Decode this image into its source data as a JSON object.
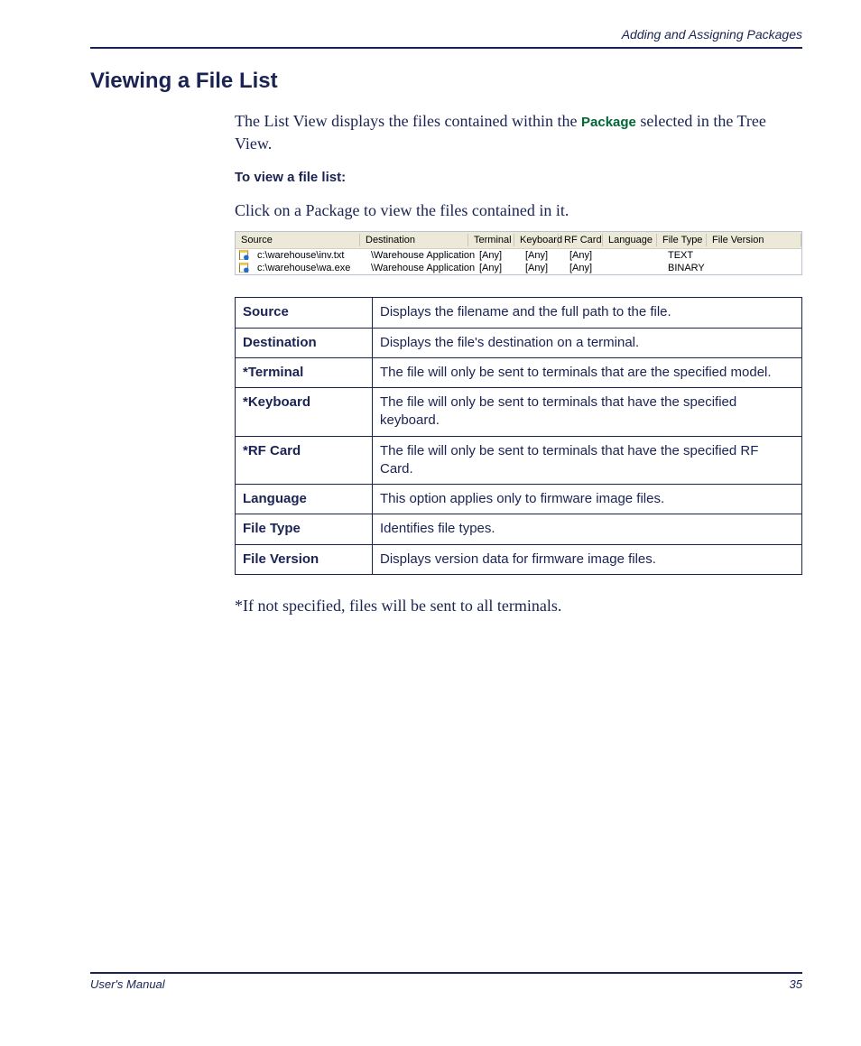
{
  "header": {
    "breadcrumb": "Adding and Assigning Packages"
  },
  "section": {
    "title": "Viewing a File List",
    "intro_pre": "The List View displays the files contained within the ",
    "intro_term": "Package",
    "intro_post": " selected in the Tree View.",
    "sub_heading": "To view a file list:",
    "instruction": "Click on a Package to view the files contained in it.",
    "footnote": "*If not specified, files will be sent to all terminals."
  },
  "screenshot": {
    "headers": [
      "Source",
      "Destination",
      "Terminal",
      "Keyboard",
      "RF Card",
      "Language",
      "File Type",
      "File Version"
    ],
    "rows": [
      {
        "source": "c:\\warehouse\\inv.txt",
        "destination": "\\Warehouse Application",
        "terminal": "[Any]",
        "keyboard": "[Any]",
        "rfcard": "[Any]",
        "language": "",
        "filetype": "TEXT",
        "fileversion": ""
      },
      {
        "source": "c:\\warehouse\\wa.exe",
        "destination": "\\Warehouse Application",
        "terminal": "[Any]",
        "keyboard": "[Any]",
        "rfcard": "[Any]",
        "language": "",
        "filetype": "BINARY",
        "fileversion": ""
      }
    ]
  },
  "desc_table": [
    {
      "key": "Source",
      "val": "Displays the filename and the full path to the file."
    },
    {
      "key": "Destination",
      "val": "Displays the file's destination on a terminal."
    },
    {
      "key": "*Terminal",
      "val": "The file will only be sent to terminals that are the specified model."
    },
    {
      "key": "*Keyboard",
      "val": "The file will only be sent to terminals that have the specified keyboard."
    },
    {
      "key": "*RF Card",
      "val": "The file will only be sent to terminals that have the specified RF Card."
    },
    {
      "key": "Language",
      "val": "This option applies only to firmware image files."
    },
    {
      "key": "File Type",
      "val": "Identifies file types."
    },
    {
      "key": "File Version",
      "val": "Displays version data for firmware image files."
    }
  ],
  "footer": {
    "left": "User's Manual",
    "right": "35"
  }
}
